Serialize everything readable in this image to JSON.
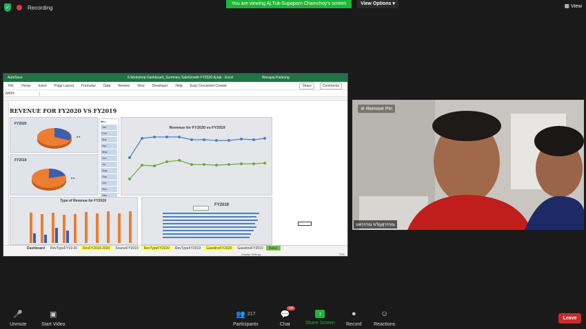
{
  "top": {
    "recording_label": "Recording",
    "viewing_banner": "You are viewing Aj.Tuk-Supaporn Chamchoy's screen",
    "view_options": "View Options",
    "view_button": "View"
  },
  "excel": {
    "autosave": "AutoSave",
    "title": "6.Workshop Dashboard_Summary SaleGrowth FY2020 Aj.tuk - Excel",
    "user": "Worapoj Padsong",
    "menu": [
      "File",
      "Home",
      "Insert",
      "Page Layout",
      "Formulas",
      "Data",
      "Review",
      "View",
      "Developer",
      "Help",
      "Easy Document Creator"
    ],
    "share": "Share",
    "comments": "Comments",
    "name_box": "AA34",
    "dashboard_title": "REVENUE FOR FY2020 VS FY2019",
    "pie1_title": "FY2020",
    "pie2_title": "FY2019",
    "slicer_header": "Mo...",
    "months": [
      "Jan",
      "Feb",
      "Mar",
      "Apr",
      "May",
      "Jun",
      "Jul",
      "Aug",
      "Sep",
      "Oct",
      "Nov",
      "Dec"
    ],
    "line_chart_title": "Revenue for FY2020 vs FY2019",
    "bar1_title": "Type of Revenue for FY2019",
    "bar2_title": "FY2019",
    "chart_area_tip": "Chart Area",
    "tabs": [
      "Dashboard",
      "RevTypeFY19-20",
      "RevFY2019-2020",
      "SourceFY2019",
      "RevTypeFY2020",
      "RevTypeFY2019",
      "GasolineFY2020",
      "GasolineFY2019",
      "Data1"
    ],
    "display_settings": "Display Settings",
    "zoom": "70%",
    "colors": {
      "excel_green": "#217346",
      "fy2020_line": "#4a7fc1",
      "fy2019_line": "#6aaa3a",
      "pie_blue": "#3a5fb0",
      "pie_orange": "#ec7d31"
    }
  },
  "video": {
    "remove_pin": "Remove Pin",
    "participant_name": "นพวรรณ ขวัญสุวรรณ"
  },
  "bottom": {
    "unmute": "Unmute",
    "start_video": "Start Video",
    "participants": "Participants",
    "participants_count": "217",
    "chat": "Chat",
    "chat_badge": "14",
    "share_screen": "Share Screen",
    "record": "Record",
    "reactions": "Reactions",
    "leave": "Leave"
  }
}
